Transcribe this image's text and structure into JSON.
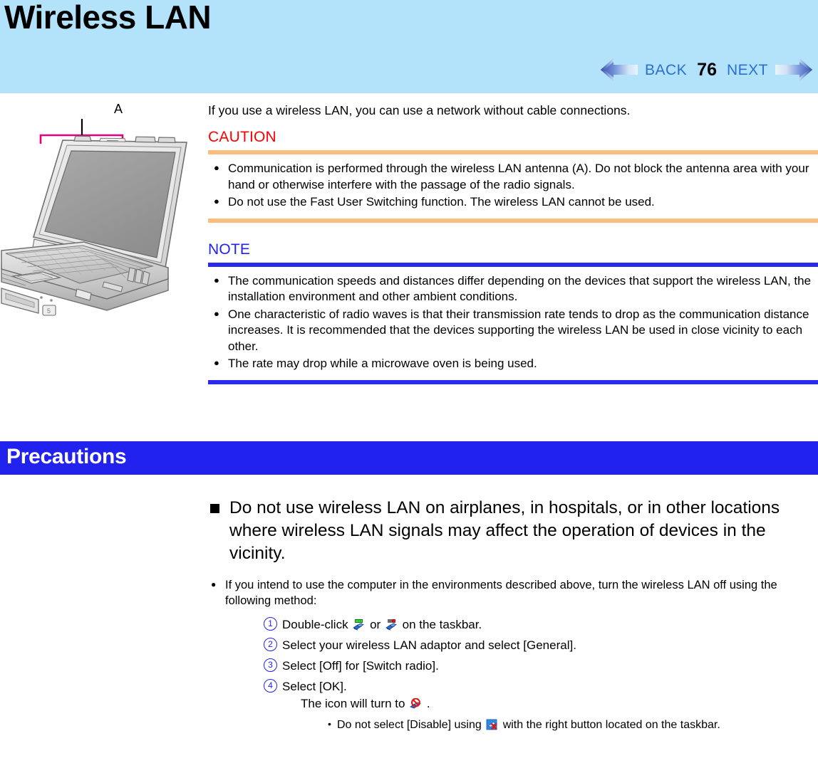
{
  "header": {
    "title": "Wireless LAN",
    "band_color": "#b3e3fa"
  },
  "nav": {
    "back_label": "BACK",
    "next_label": "NEXT",
    "page_number": "76",
    "back_icon": "left-arrow-icon",
    "next_icon": "right-arrow-icon",
    "link_color": "#2b6fd4"
  },
  "illustration": {
    "name": "laptop-wireless-antenna-diagram",
    "callout_label": "A",
    "callout_color": "#e6007e"
  },
  "main": {
    "intro": "If you use a wireless LAN, you can use a network without cable connections.",
    "caution": {
      "heading": "CAUTION",
      "heading_color": "#ff0000",
      "rule_color": "#fbbe7e",
      "items": [
        "Communication is performed through the wireless LAN antenna (A).  Do not block the antenna area with your hand or otherwise interfere with the passage of the radio signals.",
        "Do not use the Fast User Switching function. The wireless LAN cannot be used."
      ]
    },
    "note": {
      "heading": "NOTE",
      "heading_color": "#2222ee",
      "rule_color": "#2a2aee",
      "items": [
        "The communication speeds and distances differ depending on the devices that support the wireless LAN, the installation environment and other ambient conditions.",
        "One characteristic of radio waves is that their transmission rate tends to drop as the communication distance increases.  It is recommended that the devices supporting the wireless LAN be used in close vicinity to each other.",
        "The rate may drop while a microwave oven is being used."
      ]
    }
  },
  "precautions": {
    "bar_title": "Precautions",
    "bar_color": "#2222ee",
    "bar_text_color": "#ffffff",
    "heading": "Do not use wireless LAN on airplanes, in hospitals, or in other locations where wireless LAN signals may affect the operation of devices in the vicinity.",
    "bullet": "If you intend to use the computer in the environments described above, turn the wireless LAN off using the following method:",
    "steps": [
      {
        "number": "1",
        "text_before": "Double-click",
        "icon1": "wireless-network-connected-icon",
        "text_middle": "or",
        "icon2": "wireless-network-disconnected-icon",
        "text_after": "on the taskbar."
      },
      {
        "number": "2",
        "text": "Select your wireless LAN adaptor and select [General]."
      },
      {
        "number": "3",
        "text": "Select [Off] for [Switch radio]."
      },
      {
        "number": "4",
        "text": "Select [OK]."
      }
    ],
    "step4_substep_before": "The icon will turn to",
    "step4_substep_icon": "wireless-network-radio-off-icon",
    "step4_substep_after": ".",
    "subbullet_before": "Do not select [Disable] using",
    "subbullet_icon": "network-adapter-disabled-icon",
    "subbullet_after": "with the right button located on the taskbar."
  }
}
